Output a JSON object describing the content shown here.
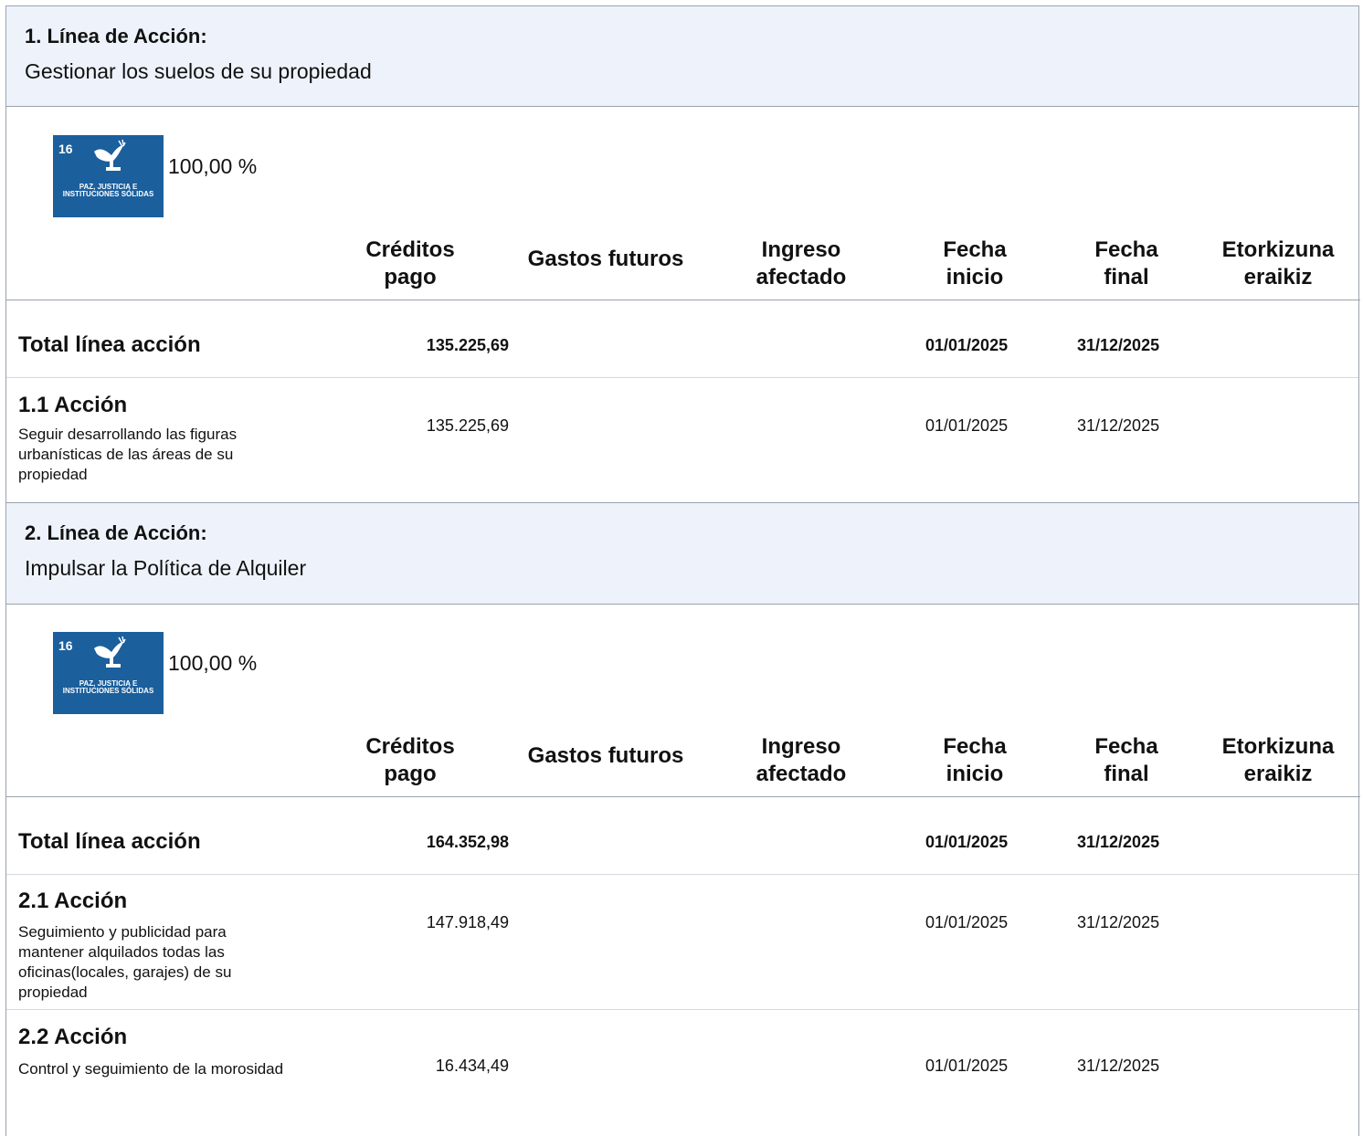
{
  "ods_badge": {
    "number": "16",
    "text": "PAZ, JUSTICIA E INSTITUCIONES SÓLIDAS"
  },
  "columns": [
    "Créditos pago",
    "Gastos futuros",
    "Ingreso afectado",
    "Fecha inicio",
    "Fecha final",
    "Etorkizuna eraikiz"
  ],
  "lines": [
    {
      "title": "1. Línea de Acción:",
      "subtitle": "Gestionar los suelos de su propiedad",
      "percentage": "100,00 %",
      "total": {
        "label": "Total línea acción",
        "creditos": "135.225,69",
        "fecha_inicio": "01/01/2025",
        "fecha_final": "31/12/2025"
      },
      "actions": [
        {
          "title": "1.1 Acción",
          "description": "Seguir desarrollando las figuras urbanísticas de las áreas de su propiedad",
          "creditos": "135.225,69",
          "fecha_inicio": "01/01/2025",
          "fecha_final": "31/12/2025"
        }
      ]
    },
    {
      "title": "2. Línea de Acción:",
      "subtitle": "Impulsar la Política de Alquiler",
      "percentage": "100,00 %",
      "total": {
        "label": "Total línea acción",
        "creditos": "164.352,98",
        "fecha_inicio": "01/01/2025",
        "fecha_final": "31/12/2025"
      },
      "actions": [
        {
          "title": "2.1 Acción",
          "description": "Seguimiento y publicidad para mantener alquilados todas las oficinas(locales, garajes) de su propiedad",
          "creditos": "147.918,49",
          "fecha_inicio": "01/01/2025",
          "fecha_final": "31/12/2025"
        },
        {
          "title": "2.2 Acción",
          "description": "Control y seguimiento de la morosidad",
          "creditos": "16.434,49",
          "fecha_inicio": "01/01/2025",
          "fecha_final": "31/12/2025"
        }
      ]
    }
  ]
}
